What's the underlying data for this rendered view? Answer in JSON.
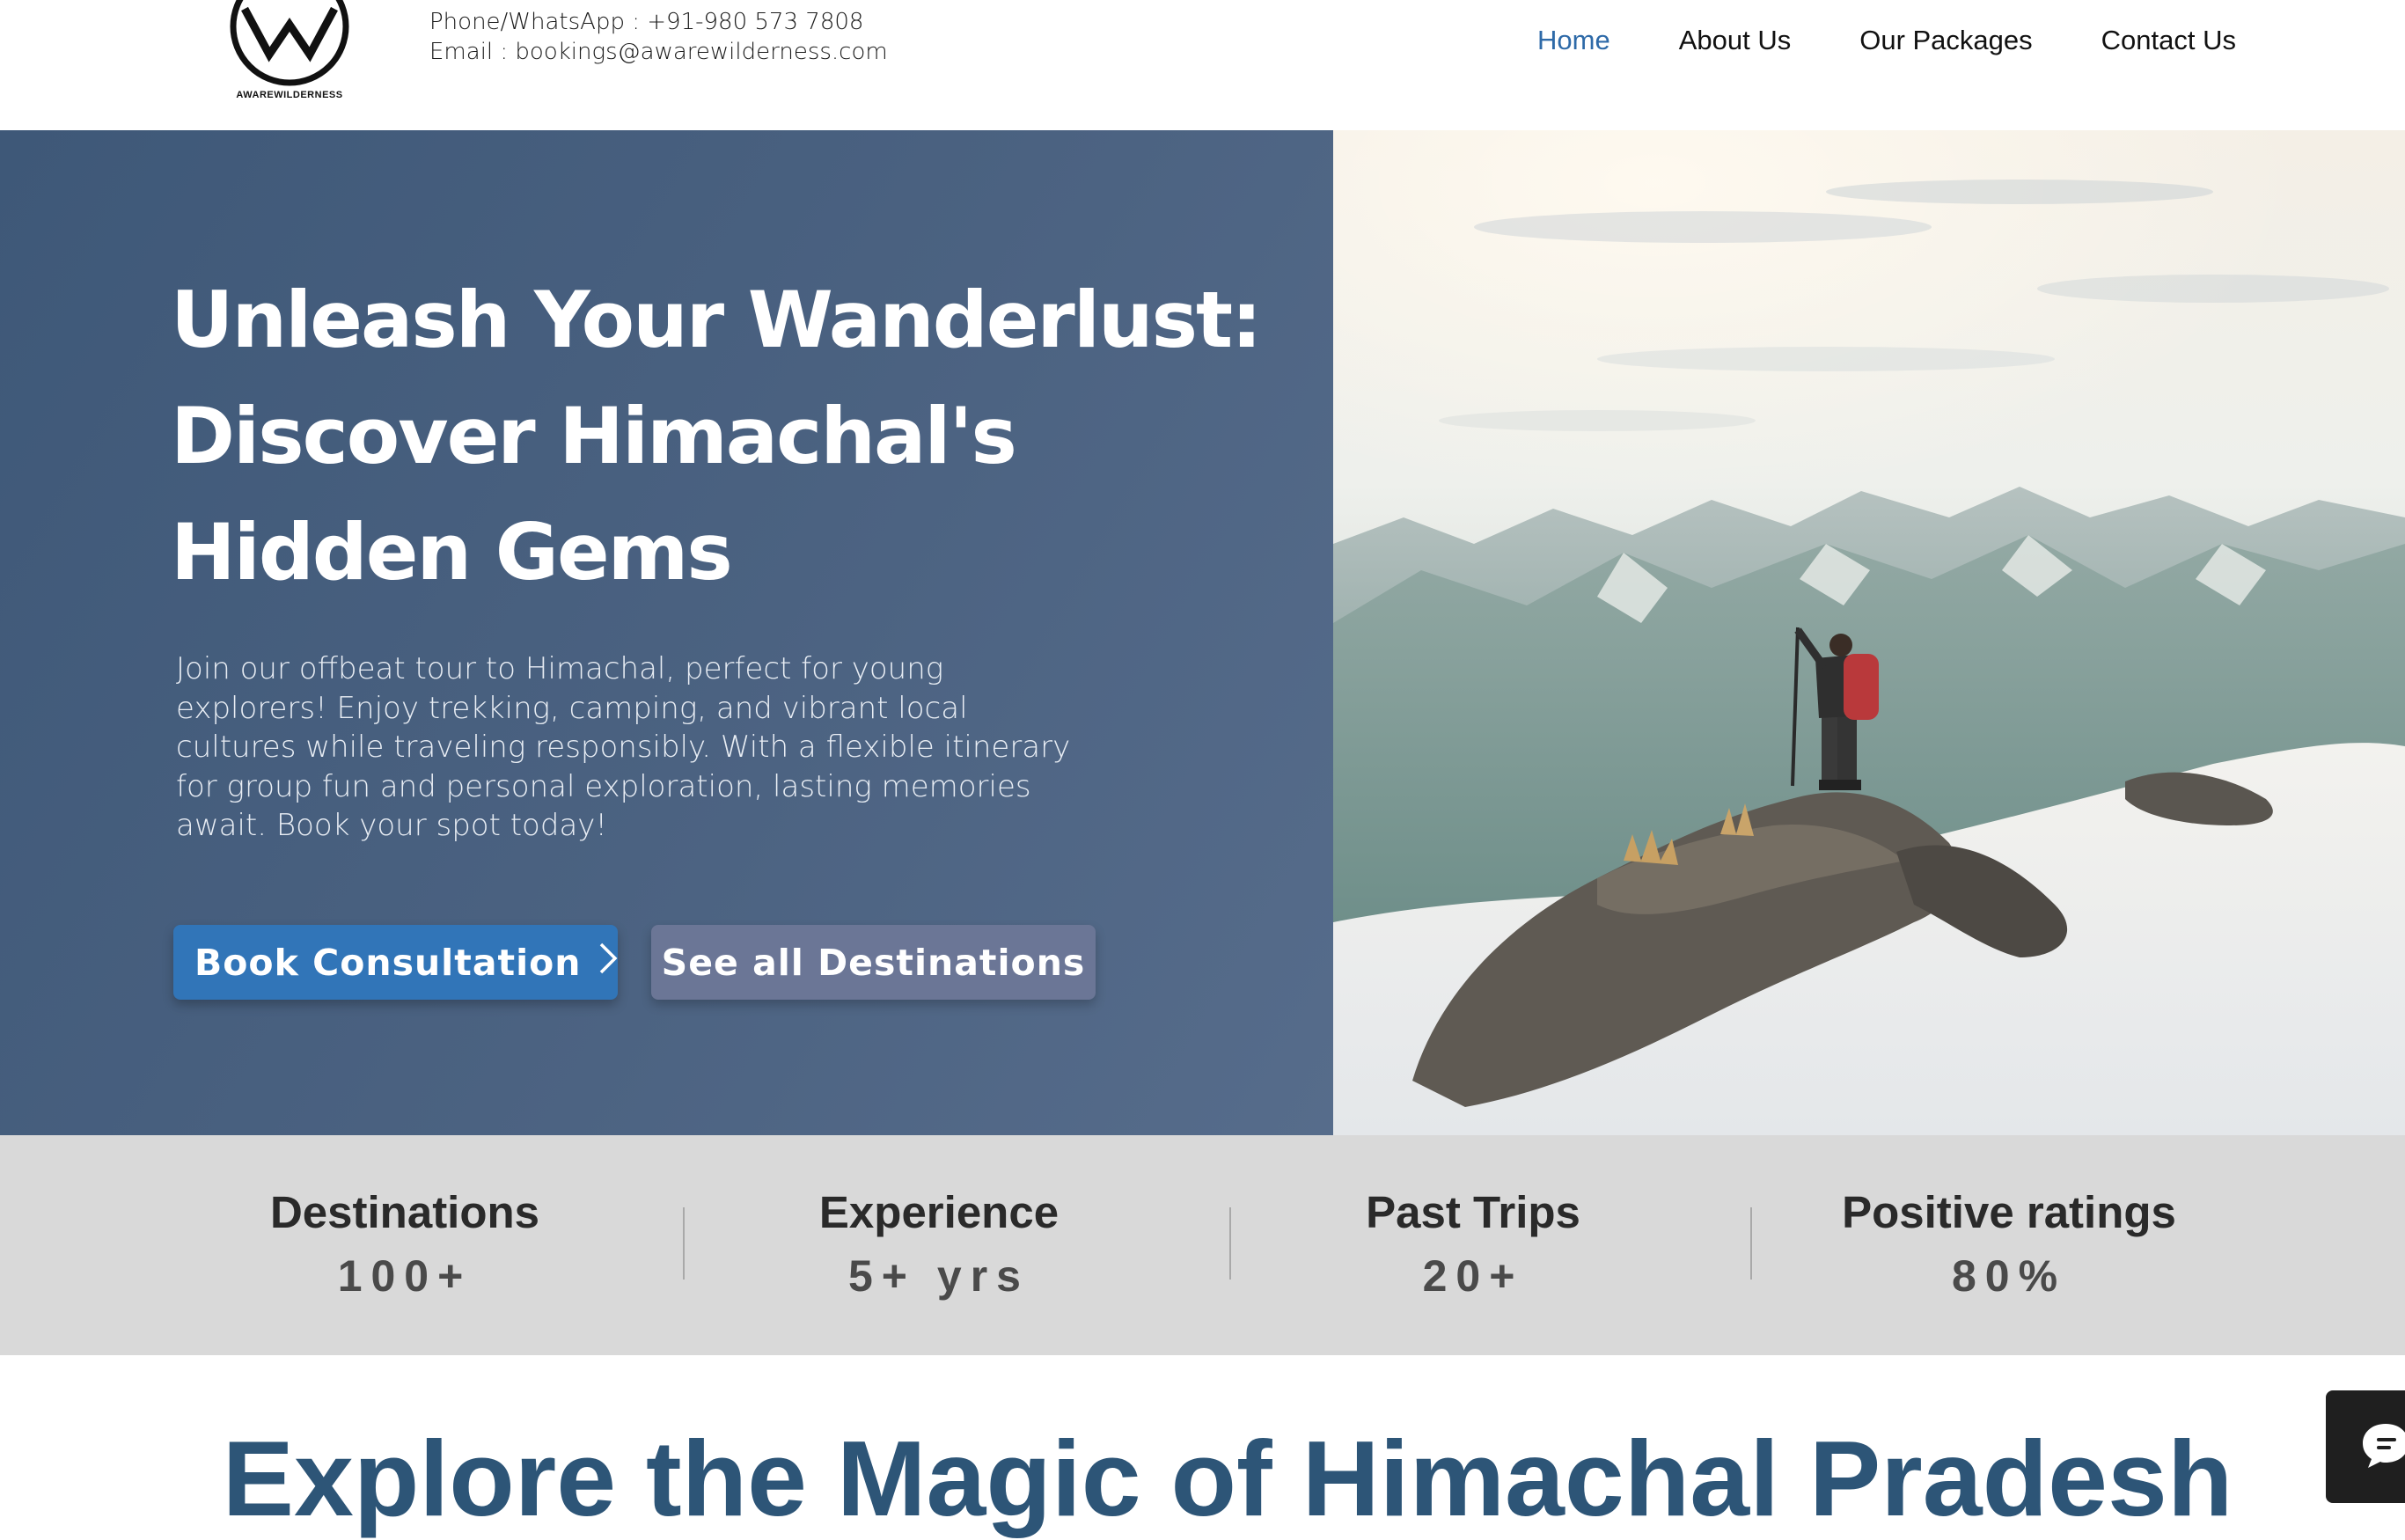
{
  "header": {
    "logo_text": "AWAREWILDERNESS",
    "phone": "Phone/WhatsApp : +91-980 573 7808",
    "email": "Email : bookings@awarewilderness.com",
    "nav": [
      {
        "label": "Home",
        "active": true
      },
      {
        "label": "About Us",
        "active": false
      },
      {
        "label": "Our Packages",
        "active": false
      },
      {
        "label": "Contact Us",
        "active": false
      }
    ]
  },
  "hero": {
    "title_line1": "Unleash Your Wanderlust:",
    "title_line2": "Discover Himachal's",
    "title_line3": "Hidden Gems",
    "description": "Join our offbeat tour to Himachal, perfect for young explorers! Enjoy trekking, camping, and vibrant local cultures while traveling responsibly. With a flexible itinerary for group fun and personal exploration, lasting memories await. Book your spot today!",
    "primary_button": "Book Consultation",
    "secondary_button": "See all Destinations"
  },
  "stats": [
    {
      "label": "Destinations",
      "value": "100+"
    },
    {
      "label": "Experience",
      "value": "5+ yrs"
    },
    {
      "label": "Past Trips",
      "value": "20+"
    },
    {
      "label": "Positive ratings",
      "value": "80%"
    }
  ],
  "section": {
    "title": "Explore the Magic of Himachal Pradesh"
  },
  "icons": {
    "logo": "mountain-logo-icon",
    "chevron": "chevron-right-icon",
    "chat": "chat-icon"
  },
  "colors": {
    "accent_nav": "#2e6aa8",
    "primary_button": "#3175b8",
    "secondary_button": "#6b7696",
    "hero_panel": "#4b6281",
    "section_title": "#2d5577",
    "stats_band": "#d9d9d9"
  }
}
